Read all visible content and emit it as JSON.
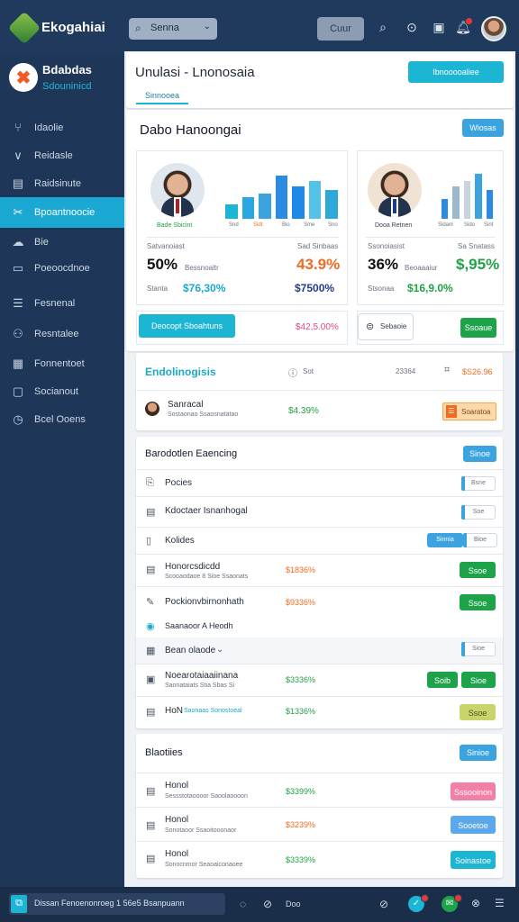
{
  "app": {
    "name": "Ekogahiai"
  },
  "topbar": {
    "search_label": "Senna",
    "pill_label": "Cuur",
    "icons": [
      "search-icon",
      "help-icon",
      "calendar-icon",
      "bell-icon"
    ],
    "accent": "#1cb5d4"
  },
  "sidebar": {
    "brand_title": "Bdabdas",
    "brand_sub": "Sdouninicd",
    "items": [
      {
        "label": "Idaolie",
        "icon": "branch-icon"
      },
      {
        "label": "Reidasle",
        "icon": "chart-icon"
      },
      {
        "label": "Raidsinute",
        "icon": "calendar-icon"
      },
      {
        "label": "Bpoantnoocie",
        "icon": "tools-icon",
        "active": true
      },
      {
        "label": "Bie",
        "icon": "cloud-icon"
      },
      {
        "label": "Poeoocdnoe",
        "icon": "folder-icon"
      },
      {
        "label": "Fesnenal",
        "icon": "document-icon"
      },
      {
        "label": "Resntalee",
        "icon": "people-icon"
      },
      {
        "label": "Fonnentoet",
        "icon": "calendar-check-icon"
      },
      {
        "label": "Socianout",
        "icon": "chat-icon"
      },
      {
        "label": "Bcel Ooens",
        "icon": "clock-icon"
      }
    ]
  },
  "header": {
    "title": "Unulasi - Lnonosaia",
    "action_label": "Ibnooooaliee",
    "tab_label": "Sinnooea"
  },
  "overview": {
    "title": "Dabo Hanoongai",
    "button_label": "Wiosas",
    "cards": [
      {
        "person_name": "Bade Sbicint",
        "bar_labels": [
          "Snd",
          "Sidt",
          "Bio",
          "Sme",
          "Sno"
        ],
        "bars": [
          0.28,
          0.42,
          0.48,
          0.82,
          0.62,
          0.72,
          0.55
        ],
        "stat_label_left": "Satvanoiast",
        "stat_label_right": "Sad Sinbaas",
        "big_value": "50%",
        "big_sub": "Bessnoaltr",
        "big_value_right": "43.9%",
        "foot_label": "Stanta",
        "foot_value_left": "$76,30%",
        "foot_value_right": "$7500%"
      },
      {
        "person_name": "Dooa Retnen",
        "bar_labels": [
          "Sidanl",
          "Sido",
          "Sint"
        ],
        "bars": [
          0.38,
          0.62,
          0.72,
          0.86,
          0.55
        ],
        "stat_label_left": "Ssonoiasist",
        "stat_label_right": "Sa Snatass",
        "big_value": "36%",
        "big_sub": "Beoaaaiur",
        "big_value_right": "$,95%",
        "foot_label": "Stsonaa",
        "foot_value_left": "$16,9.0%"
      }
    ],
    "strip_left_button": "Deocopt Sboahtuns",
    "strip_left_value": "$42,5.00%",
    "strip_right_chip": "Sebaoie",
    "strip_right_button": "Ssoaue"
  },
  "activity": {
    "title": "Endolinogisis",
    "mid_label": "Sot",
    "count_label": "23364",
    "price": "$S26.96",
    "row_name": "Sanracal",
    "row_sub": "Sostaonao Ssaosnatatao",
    "row_value": "$4.39%",
    "row_button": "Soaratoa"
  },
  "list": {
    "title": "Barodotlen Eaencing",
    "button_label": "Sinoe",
    "rows": [
      {
        "icon": "document-icon",
        "name": "Pocies",
        "toggle": "Bsne"
      },
      {
        "icon": "clipboard-icon",
        "name": "Kdoctaer Isnanhogal",
        "toggle": "Soe"
      },
      {
        "icon": "page-icon",
        "name": "Kolides",
        "toggle_left": "Sinnia",
        "toggle": "Bioe"
      },
      {
        "icon": "clipboard-icon",
        "name": "Honorcsdicdd",
        "sub": "Scooaodaoe 8 Sioe Ssaonats",
        "value": "$1836%",
        "button": "Ssoe"
      },
      {
        "icon": "edit-icon",
        "name": "Pockionvbirnonhath",
        "value": "$9336%",
        "button": "Ssoe"
      },
      {
        "icon": "circle-icon",
        "name": "Saanaoor A Heodh"
      },
      {
        "icon": "grid-icon",
        "name": "Bean olaode",
        "toggle": "Sioe"
      },
      {
        "icon": "calendar-icon",
        "name": "Noearotaiaaiinana",
        "sub": "Saonataiats Stia Sbas Si",
        "value": "$3336%",
        "button_left": "Soib",
        "button": "Sioe"
      },
      {
        "icon": "clipboard-icon",
        "name": "HoN",
        "sub_teal": "Saonaas Sonostoeal",
        "value": "$1336%",
        "button": "Ssoe"
      }
    ]
  },
  "bottom_list": {
    "title": "Blaotiies",
    "button_label": "Sinioe",
    "rows": [
      {
        "name": "Honol",
        "sub": "Sessstotaoooor Saoolaoooon",
        "value": "$3399%",
        "button": "Sssooinon",
        "button_color": "#f27fa6"
      },
      {
        "name": "Honol",
        "sub": "Sonotaoor Ssaoitooonaor",
        "value": "$3239%",
        "button": "Sooetoe",
        "button_color": "#5ba8ea"
      },
      {
        "name": "Honol",
        "sub": "Sonocnmor Seaoaiconaoee",
        "value": "$3339%",
        "button": "Soinastoe",
        "button_color": "#1cb5d4"
      }
    ]
  },
  "taskbar": {
    "text": "Dissan Fenoenonroeg 1 56e5 Bsanpuann",
    "label_mid": "Doo"
  }
}
